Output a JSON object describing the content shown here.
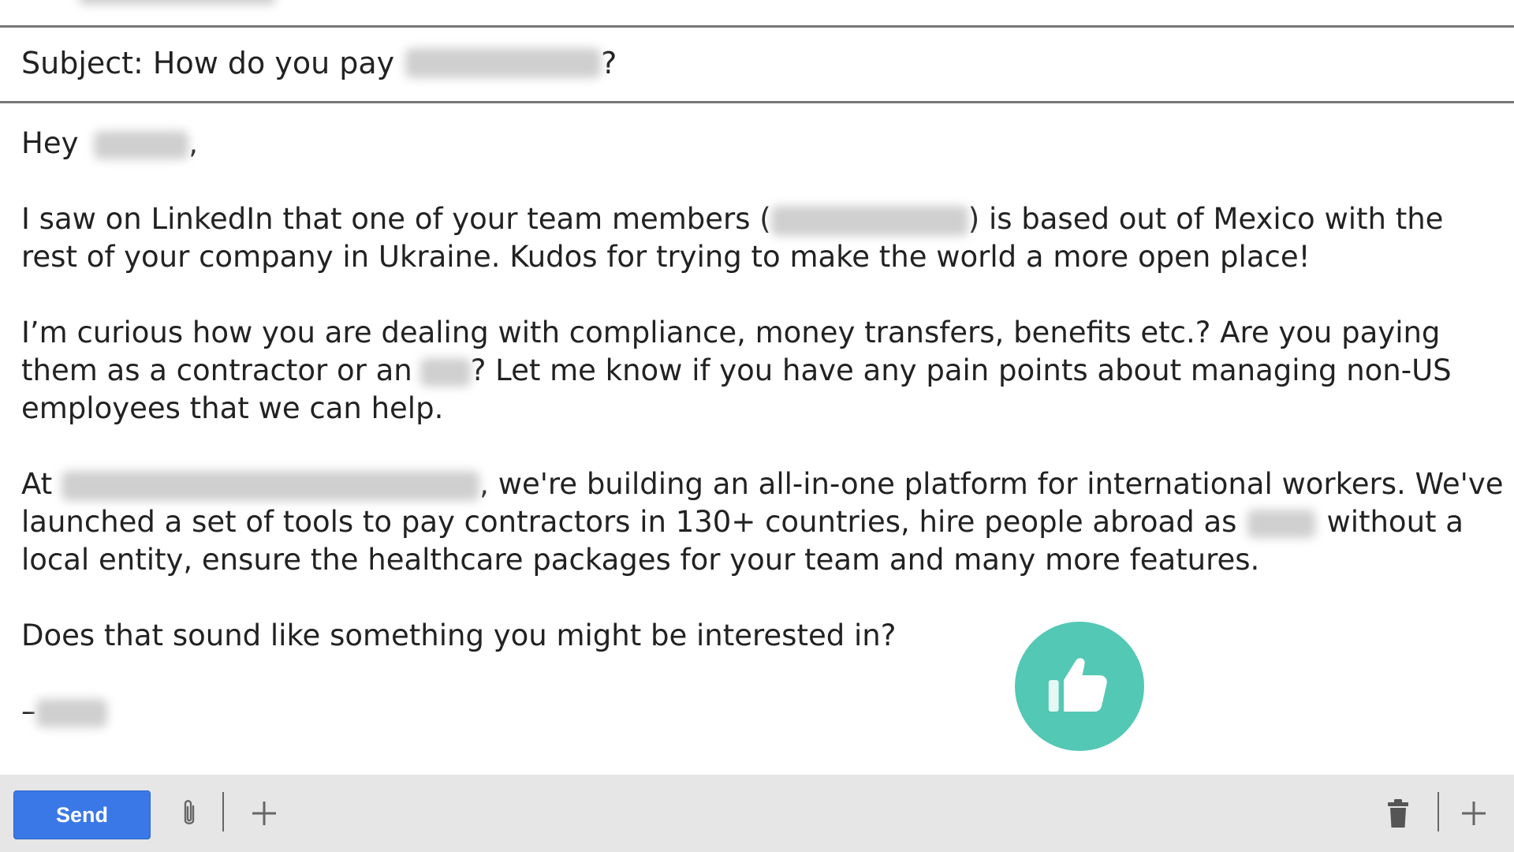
{
  "email": {
    "subject_prefix": "Subject: How do you pay",
    "subject_suffix": "?",
    "body": {
      "greeting": "Hey",
      "greeting_comma": ",",
      "p1_l1_a": "I saw on LinkedIn that one of your team members (",
      "p1_l1_b": ") is based out of Mexico with the",
      "p1_l2": "rest of your company in Ukraine. Kudos for trying to make the world a more open place!",
      "p2_l1": "I’m curious how you are dealing with compliance, money transfers, benefits etc.? Are you paying",
      "p2_l2_a": "them as a contractor or an",
      "p2_l2_b": "? Let me know if you have any pain points about managing non-US",
      "p2_l3": "employees that we can help.",
      "p3_l1_a": "At",
      "p3_l1_b": ", we're building an all-in-one platform for international workers. We've",
      "p3_l2_a": "launched a set of tools to pay contractors in 130+ countries, hire people abroad as",
      "p3_l2_b": "without a",
      "p3_l3": "local entity, ensure the healthcare packages for your team and many more features.",
      "p4": "Does that sound like something you might be interested in?",
      "signoff_dash": "–"
    }
  },
  "toolbar": {
    "send_label": "Send"
  },
  "icons": {
    "attach": "paperclip-icon",
    "more_left": "plus-icon",
    "trash": "trash-icon",
    "more_right": "plus-icon",
    "reaction": "thumbs-up-icon"
  },
  "colors": {
    "send_button": "#3b78e7",
    "thumbs_up_circle": "#53c8b4",
    "toolbar_bg": "#e6e6e6",
    "divider": "#777777"
  }
}
